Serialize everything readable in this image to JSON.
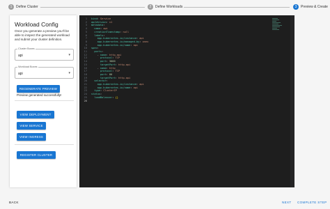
{
  "stepper": {
    "steps": [
      {
        "number": "1",
        "label": "Define Cluster"
      },
      {
        "number": "2",
        "label": "Define Workloads"
      },
      {
        "number": "3",
        "label": "Preview & Create"
      }
    ]
  },
  "panel": {
    "title": "Workload Config",
    "description": "Once you generate a preview you'll be able to inspect the generated workload and submit your cluster definition.",
    "cluster_boxes": {
      "label": "Cluster Boxes",
      "value": "api"
    },
    "workload_boxes": {
      "label": "Workload Boxes",
      "value": "api"
    },
    "regenerate_label": "REGENERATE PREVIEW",
    "status": "Preview generated successfully!",
    "view_deployment": "VIEW DEPLOYMENT",
    "view_service": "VIEW SERVICE",
    "view_ingress": "VIEW INGRESS",
    "register_cluster": "REGISTER CLUSTER"
  },
  "editor": {
    "lines": [
      {
        "n": "1",
        "text": "kind: Service"
      },
      {
        "n": "2",
        "text": "apiVersion: v1"
      },
      {
        "n": "3",
        "text": "metadata:"
      },
      {
        "n": "4",
        "text": "  name: api"
      },
      {
        "n": "5",
        "text": "  creationTimestamp: null"
      },
      {
        "n": "6",
        "text": "  labels:"
      },
      {
        "n": "7",
        "text": "    app.kubernetes.io/instance: api"
      },
      {
        "n": "8",
        "text": "    app.kubernetes.io/managed-by: onex"
      },
      {
        "n": "9",
        "text": "    app.kubernetes.io/name: api"
      },
      {
        "n": "10",
        "text": "spec:"
      },
      {
        "n": "11",
        "text": "  ports:"
      },
      {
        "n": "12",
        "text": "    - name: http-api"
      },
      {
        "n": "13",
        "text": "      protocol: TCP"
      },
      {
        "n": "14",
        "text": "      port: 3000"
      },
      {
        "n": "15",
        "text": "      targetPort: http-api"
      },
      {
        "n": "16",
        "text": "    - name: http"
      },
      {
        "n": "17",
        "text": "      protocol: TCP"
      },
      {
        "n": "18",
        "text": "      port: 80"
      },
      {
        "n": "19",
        "text": "      targetPort: http-api"
      },
      {
        "n": "20",
        "text": "  selector:"
      },
      {
        "n": "21",
        "text": "    app.kubernetes.io/instance: api"
      },
      {
        "n": "22",
        "text": "    app.kubernetes.io/name: api"
      },
      {
        "n": "23",
        "text": "  type: ClusterIP"
      },
      {
        "n": "24",
        "text": "status:"
      },
      {
        "n": "25",
        "text": "  loadBalancer: {}"
      },
      {
        "n": "26",
        "text": ""
      }
    ]
  },
  "footer": {
    "back": "BACK",
    "next": "NEXT",
    "complete": "COMPLETE STEP"
  },
  "colors": {
    "accent": "#1976d2",
    "editor_bg": "#1e1e1e",
    "key": "#4ec9b0",
    "string": "#ce9178",
    "number": "#b5cea8"
  }
}
